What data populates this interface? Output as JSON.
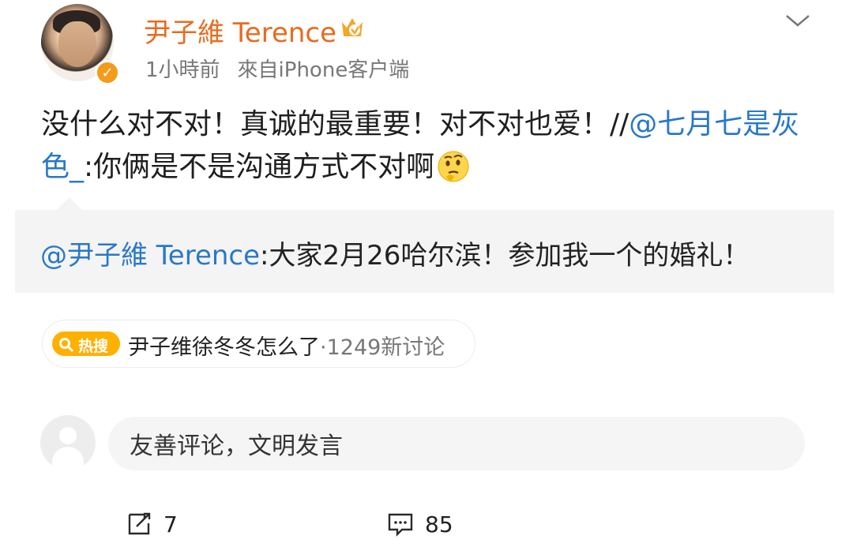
{
  "post": {
    "author": "尹子維 Terence",
    "time": "1小時前",
    "source": "來自iPhone客户端",
    "text_before_mention": "没什么对不对！真诚的最重要！对不对也爱！//",
    "mention": "@七月七是灰色_",
    "text_after_mention": ":你俩是不是沟通方式不对啊",
    "emoji": "thinking-emoji"
  },
  "quoted": {
    "mention": "@尹子維 Terence",
    "text": ":大家2月26哈尔滨！参加我一个的婚礼！"
  },
  "hot_search": {
    "badge": "热搜",
    "topic": "尹子维徐冬冬怎么了",
    "count": "·1249新讨论"
  },
  "comment_box": {
    "placeholder": "友善评论，文明发言"
  },
  "actions": {
    "repost_count": "7",
    "comment_count": "85"
  },
  "icons": {
    "verified": "verified-badge-icon",
    "vip": "vip-crown-icon",
    "more": "chevron-down-icon",
    "repost": "repost-icon",
    "comment": "comment-icon"
  },
  "colors": {
    "name": "#e86b1e",
    "mention": "#2a78c8",
    "hot_badge": "#ffb000"
  }
}
